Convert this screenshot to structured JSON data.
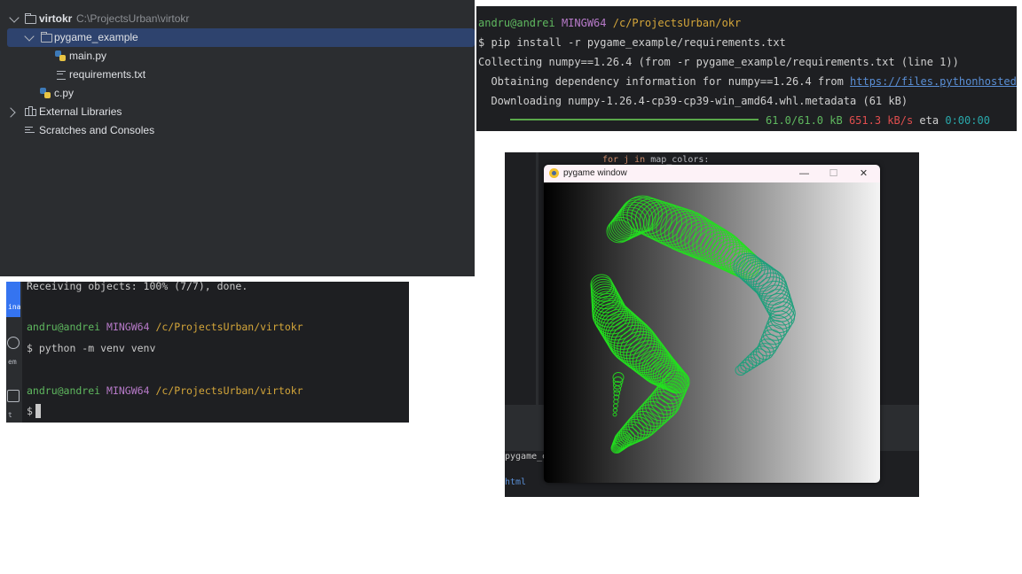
{
  "project_tree": {
    "root": {
      "name": "virtokr",
      "path": "C:\\ProjectsUrban\\virtokr"
    },
    "items": [
      {
        "label": "pygame_example"
      },
      {
        "label": "main.py"
      },
      {
        "label": "requirements.txt"
      },
      {
        "label": "c.py"
      },
      {
        "label": "External Libraries"
      },
      {
        "label": "Scratches and Consoles"
      }
    ]
  },
  "bash_terminal": {
    "side_labels": [
      "inal",
      "em",
      "t"
    ],
    "line1": "Receiving objects: 100% (7/7), done.",
    "prompt1": {
      "user": "andru@andrei",
      "shell": "MINGW64",
      "path": "/c/ProjectsUrban/virtokr"
    },
    "cmd1": "$ python -m venv venv",
    "prompt2": {
      "user": "andru@andrei",
      "shell": "MINGW64",
      "path": "/c/ProjectsUrban/virtokr"
    },
    "cmd2": "$"
  },
  "pip_terminal": {
    "prompt": {
      "user": "andru@andrei",
      "shell": "MINGW64",
      "path": "/c/ProjectsUrban/okr"
    },
    "cmd": "$ pip install -r pygame_example/requirements.txt",
    "collecting": "Collecting numpy==1.26.4 (from -r pygame_example/requirements.txt (line 1))",
    "obtaining": "  Obtaining dependency information for numpy==1.26.4 from ",
    "obtaining_link": "https://files.pythonhosted.or",
    "downloading": "  Downloading numpy-1.26.4-cp39-cp39-win_amd64.whl.metadata (61 kB)",
    "progress": {
      "fraction": 1.0,
      "size": "61.0/61.0 kB",
      "speed": "651.3 kB/s",
      "eta_label": "eta",
      "eta": "0:00:00"
    }
  },
  "ide_background": {
    "code_keyword": "for j in ",
    "code_rest": "map_colors:",
    "panel_text1": "pygame_e",
    "panel_text2": "html"
  },
  "pygame_window": {
    "title": "pygame window",
    "minimize": "—",
    "maximize": "☐",
    "close": "✕"
  },
  "colors": {
    "prompt_user": "#5fb85f",
    "prompt_shell": "#b77ac9",
    "prompt_path": "#d4a63a",
    "link": "#5a8fd6",
    "speed": "#e04e4e",
    "eta": "#29a8ab",
    "ring_green": "#22e01e",
    "ring_teal": "#18a07a"
  }
}
